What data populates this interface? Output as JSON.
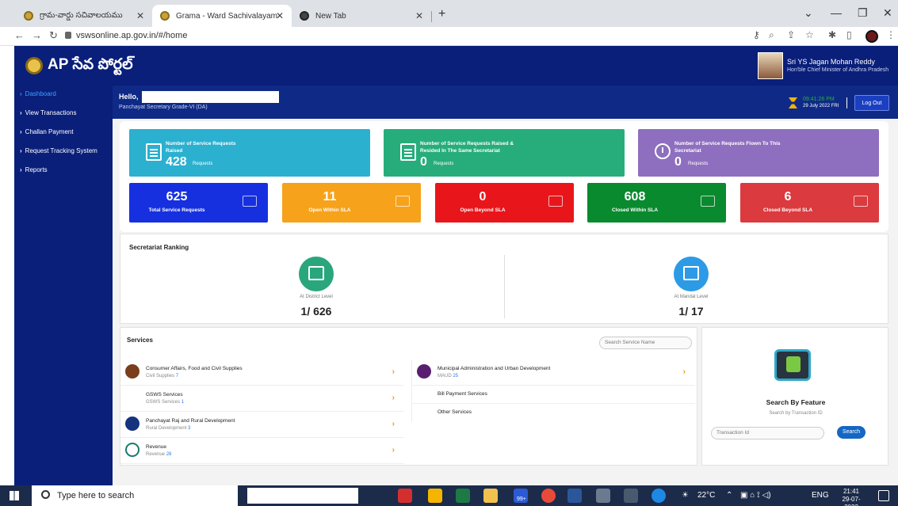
{
  "browser": {
    "tabs": [
      {
        "label": "గ్రామ-వార్డు సచివాలయము"
      },
      {
        "label": "Grama - Ward Sachivalayam"
      },
      {
        "label": "New Tab"
      }
    ],
    "url": "vswsonline.ap.gov.in/#/home"
  },
  "header": {
    "title": "AP సేవ పోర్టల్",
    "cm_name": "Sri YS Jagan Mohan Reddy",
    "cm_role": "Hon'ble Chief Minister of Andhra Pradesh"
  },
  "sidebar": {
    "items": [
      {
        "label": "Dashboard"
      },
      {
        "label": "View Transactions"
      },
      {
        "label": "Challan Payment"
      },
      {
        "label": "Request Tracking System"
      },
      {
        "label": "Reports"
      }
    ]
  },
  "user": {
    "greeting": "Hello,",
    "designation": "Panchayat Secretary Grade-VI (DA)",
    "time": "09:41:26 PM",
    "date": "29 July 2022 FRI",
    "logout_label": "Log Out"
  },
  "stats": {
    "big": [
      {
        "label": "Number of Service Requests Raised",
        "value": "428",
        "unit": "Requests",
        "color": "#2bb0d0"
      },
      {
        "label": "Number of Service Requests Raised & Resided In The Same Secretariat",
        "value": "0",
        "unit": "Requests",
        "color": "#27ad7c"
      },
      {
        "label": "Number of Service Requests Flown To This Secretariat",
        "value": "0",
        "unit": "Requests",
        "color": "#8e6fbf"
      }
    ],
    "small": [
      {
        "value": "625",
        "label": "Total Service Requests",
        "color": "#1630e0"
      },
      {
        "value": "11",
        "label": "Open Within SLA",
        "color": "#f7a21b"
      },
      {
        "value": "0",
        "label": "Open Beyond SLA",
        "color": "#e8161b"
      },
      {
        "value": "608",
        "label": "Closed Within SLA",
        "color": "#0a8a2e"
      },
      {
        "value": "6",
        "label": "Closed Beyond SLA",
        "color": "#db3a3f"
      }
    ]
  },
  "ranking": {
    "title": "Secretariat Ranking",
    "district_label": "At District Level",
    "district_value": "1/ 626",
    "mandal_label": "At Mandal Level",
    "mandal_value": "1/ 17"
  },
  "services": {
    "title": "Services",
    "search_placeholder": "Search Service Name",
    "left": [
      {
        "title": "Consumer Affairs, Food and Civil Supplies",
        "sub": "Civil Supplies",
        "count": "7"
      },
      {
        "title": "GSWS Services",
        "sub": "GSWS Services",
        "count": "1"
      },
      {
        "title": "Panchayat Raj and Rural Development",
        "sub": "Rural Development",
        "count": "3"
      },
      {
        "title": "Revenue",
        "sub": "Revenue",
        "count": "28"
      }
    ],
    "right": [
      {
        "title": "Municipal Administration and Urban Development",
        "sub": "MAUD",
        "count": "25"
      },
      {
        "title": "Bill Payment Services"
      },
      {
        "title": "Other Services"
      }
    ]
  },
  "feature": {
    "title": "Search By Feature",
    "sub": "Search by Transaction ID",
    "input_placeholder": "Transaction Id",
    "button_label": "Search"
  },
  "taskbar": {
    "search_placeholder": "Type here to search",
    "temperature": "22°C",
    "language": "ENG",
    "time": "21:41",
    "date": "29-07-2022",
    "badge": "99+"
  }
}
